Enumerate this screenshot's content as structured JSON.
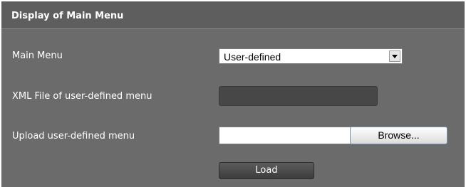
{
  "section": {
    "title": "Display of Main Menu"
  },
  "main_menu": {
    "label": "Main Menu",
    "selected": "User-defined"
  },
  "xml_file": {
    "label": "XML File of user-defined menu",
    "value": ""
  },
  "upload": {
    "label": "Upload user-defined menu",
    "value": "",
    "browse_label": "Browse..."
  },
  "actions": {
    "load_label": "Load"
  },
  "colors": {
    "panel_background": "#6b6b6b",
    "header_background": "#5e5e5e",
    "text": "#ffffff"
  }
}
